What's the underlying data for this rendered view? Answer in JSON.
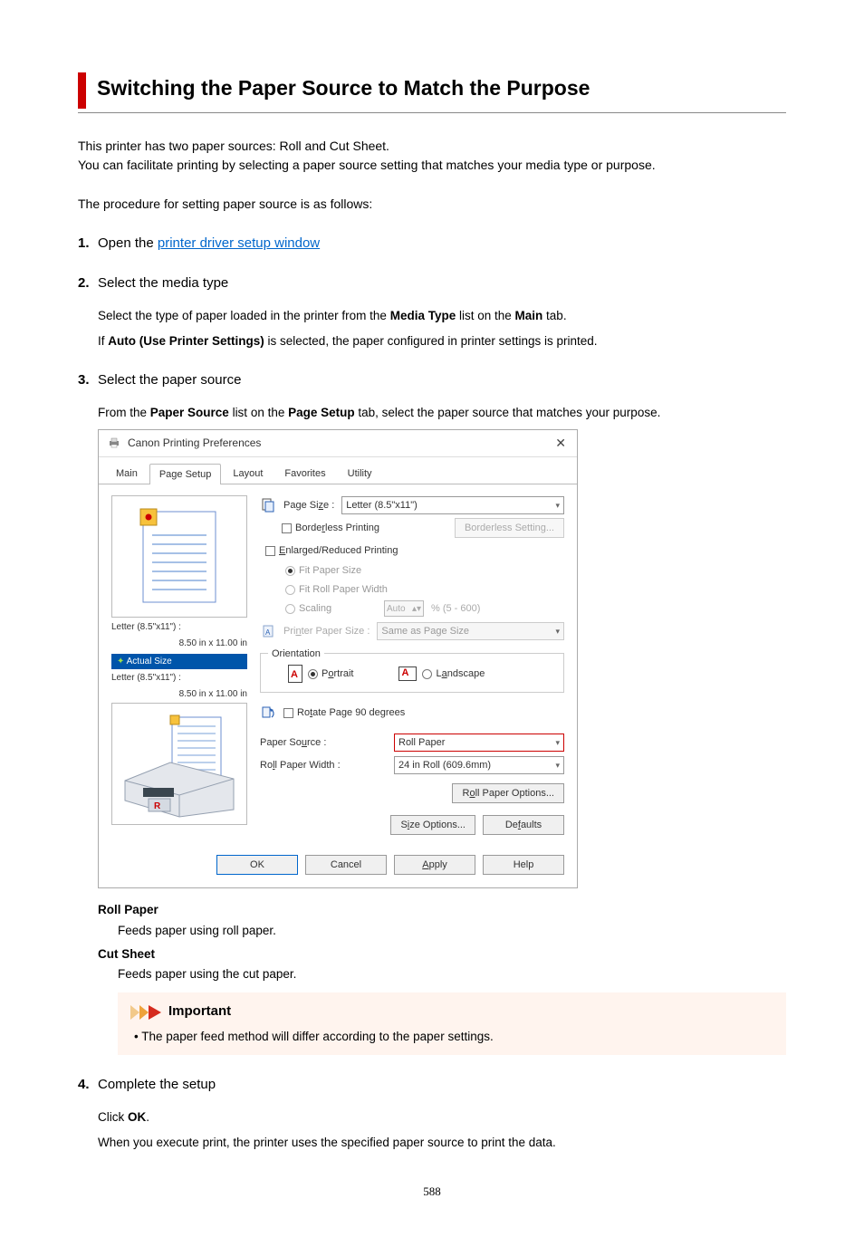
{
  "title": "Switching the Paper Source to Match the Purpose",
  "intro_lines": [
    "This printer has two paper sources: Roll and Cut Sheet.",
    "You can facilitate printing by selecting a paper source setting that matches your media type or purpose."
  ],
  "preface": "The procedure for setting paper source is as follows:",
  "steps": {
    "s1": {
      "title_a": "Open the ",
      "link": "printer driver setup window"
    },
    "s2": {
      "title": "Select the media type",
      "body_a": "Select the type of paper loaded in the printer from the ",
      "body_b": " list on the ",
      "body_c": " tab.",
      "media_type": "Media Type",
      "main_tab": "Main",
      "body2_a": "If ",
      "auto": "Auto (Use Printer Settings)",
      "body2_b": " is selected, the paper configured in printer settings is printed."
    },
    "s3": {
      "title": "Select the paper source",
      "body_a": "From the ",
      "ps": "Paper Source",
      "body_b": " list on the ",
      "tab": "Page Setup",
      "body_c": " tab, select the paper source that matches your purpose."
    },
    "s4": {
      "title": "Complete the setup",
      "body_a": "Click ",
      "ok": "OK",
      "body_b": ".",
      "body2": "When you execute print, the printer uses the specified paper source to print the data."
    }
  },
  "dialog": {
    "title": "Canon           Printing Preferences",
    "tabs": [
      "Main",
      "Page Setup",
      "Layout",
      "Favorites",
      "Utility"
    ],
    "page_size_label": "Page Size :",
    "page_size_value": "Letter (8.5\"x11\")",
    "borderless_printing": "Borderless Printing",
    "borderless_setting_btn": "Borderless Setting...",
    "enlarged_reduced": "Enlarged/Reduced Printing",
    "fit_paper_size": "Fit Paper Size",
    "fit_roll_width": "Fit Roll Paper Width",
    "scaling": "Scaling",
    "scaling_value": "Auto",
    "scaling_range": "% (5 - 600)",
    "printer_paper_size_lbl": "Printer Paper Size :",
    "printer_paper_size_val": "Same as Page Size",
    "preview1_caption_a": "Letter (8.5\"x11\") :",
    "preview1_caption_b": "8.50 in x 11.00 in",
    "actual_size": "Actual Size",
    "preview2_caption_a": "Letter (8.5\"x11\") :",
    "preview2_caption_b": "8.50 in x 11.00 in",
    "orientation": "Orientation",
    "portrait": "Portrait",
    "landscape": "Landscape",
    "rotate90": "Rotate Page 90 degrees",
    "paper_source_lbl": "Paper Source :",
    "paper_source_val": "Roll Paper",
    "roll_width_lbl": "Roll Paper Width :",
    "roll_width_val": "24 in Roll (609.6mm)",
    "roll_options_btn": "Roll Paper Options...",
    "size_options_btn": "Size Options...",
    "defaults_btn": "Defaults",
    "ok_btn": "OK",
    "cancel_btn": "Cancel",
    "apply_btn": "Apply",
    "help_btn": "Help"
  },
  "deflist": {
    "roll_t": "Roll Paper",
    "roll_d": "Feeds paper using roll paper.",
    "cut_t": "Cut Sheet",
    "cut_d": "Feeds paper using the cut paper."
  },
  "important": {
    "heading": "Important",
    "item": "The paper feed method will differ according to the paper settings."
  },
  "page_number": "588"
}
